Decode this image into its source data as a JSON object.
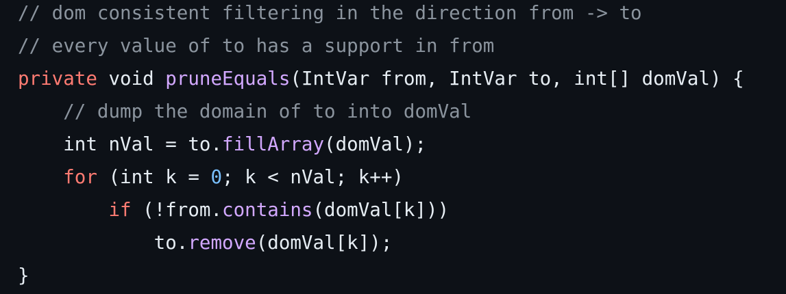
{
  "editor": {
    "colors": {
      "background": "#0d1117",
      "plain": "#e6edf3",
      "comment": "#8b949e",
      "keyword": "#ff7b72",
      "function": "#d2a8ff",
      "number": "#79c0ff"
    },
    "lines": [
      [
        {
          "t": "comment",
          "v": "// dom consistent filtering in the direction from -> to"
        }
      ],
      [
        {
          "t": "comment",
          "v": "// every value of to has a support in from"
        }
      ],
      [
        {
          "t": "keyword",
          "v": "private"
        },
        {
          "t": "plain",
          "v": " void "
        },
        {
          "t": "func",
          "v": "pruneEquals"
        },
        {
          "t": "plain",
          "v": "(IntVar from, IntVar to, int[] domVal) {"
        }
      ],
      [
        {
          "t": "plain",
          "v": "    "
        },
        {
          "t": "comment",
          "v": "// dump the domain of to into domVal"
        }
      ],
      [
        {
          "t": "plain",
          "v": "    int nVal = to."
        },
        {
          "t": "func",
          "v": "fillArray"
        },
        {
          "t": "plain",
          "v": "(domVal);"
        }
      ],
      [
        {
          "t": "plain",
          "v": "    "
        },
        {
          "t": "keyword",
          "v": "for"
        },
        {
          "t": "plain",
          "v": " (int k = "
        },
        {
          "t": "number",
          "v": "0"
        },
        {
          "t": "plain",
          "v": "; k < nVal; k++)"
        }
      ],
      [
        {
          "t": "plain",
          "v": "        "
        },
        {
          "t": "keyword",
          "v": "if"
        },
        {
          "t": "plain",
          "v": " (!from."
        },
        {
          "t": "func",
          "v": "contains"
        },
        {
          "t": "plain",
          "v": "(domVal[k]))"
        }
      ],
      [
        {
          "t": "plain",
          "v": "            to."
        },
        {
          "t": "func",
          "v": "remove"
        },
        {
          "t": "plain",
          "v": "(domVal[k]);"
        }
      ],
      [
        {
          "t": "plain",
          "v": "}"
        }
      ]
    ]
  }
}
